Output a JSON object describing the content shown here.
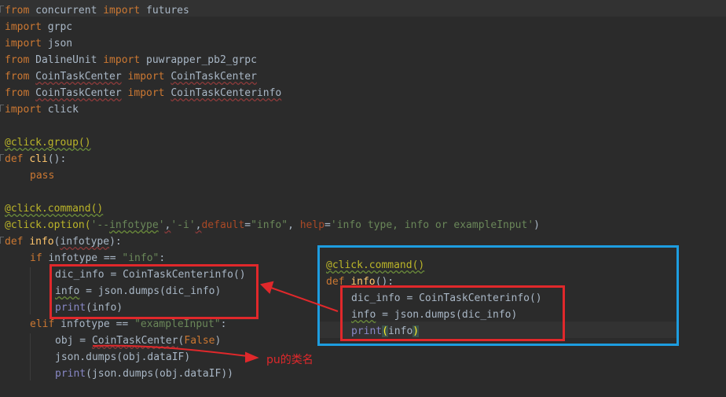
{
  "code": {
    "l1": {
      "a": "from",
      "b": " concurrent ",
      "c": "import",
      "d": " futures"
    },
    "l2": {
      "a": "import",
      "b": " grpc"
    },
    "l3": {
      "a": "import",
      "b": " json"
    },
    "l4": {
      "a": "from",
      "b": " DalineUnit ",
      "c": "import",
      "d": " puwrapper_pb2_grpc"
    },
    "l5": {
      "a": "from",
      "b": "CoinTaskCenter",
      "c": "import",
      "d": "CoinTaskCenter"
    },
    "l6": {
      "a": "from",
      "b": "CoinTaskCenter",
      "c": "import",
      "d": "CoinTaskCenterinfo"
    },
    "l7": {
      "a": "import",
      "b": " click"
    },
    "l9": {
      "a": "@click.group()"
    },
    "l10": {
      "a": "def",
      "b": "cli",
      "c": "():"
    },
    "l11": {
      "a": "pass"
    },
    "l13": {
      "a": "@click.command()"
    },
    "l14": {
      "a": "@click.option(",
      "b": "'--",
      "c": "infotype",
      "d": "'",
      "e": ",",
      "f": "'-i'",
      "g": ",",
      "h": "default",
      "i": "=",
      "j": "\"info\"",
      "k": ", ",
      "l": "help",
      "m": "=",
      "n": "'info type, info or exampleInput'",
      "o": ")"
    },
    "l15": {
      "a": "def",
      "b": "info",
      "c": "(",
      "d": "infotype",
      "e": "):"
    },
    "l16": {
      "a": "if",
      "b": " infotype == ",
      "c": "\"info\"",
      "d": ":"
    },
    "l17": {
      "a": "dic_info = CoinTaskCenterinfo()"
    },
    "l18": {
      "a": "info",
      "b": " = json.dumps(dic_info)"
    },
    "l19": {
      "a": "print",
      "b": "(info)"
    },
    "l20": {
      "a": "elif",
      "b": " infotype == ",
      "c": "\"exampleInput\"",
      "d": ":"
    },
    "l21": {
      "a": "obj = ",
      "b": "CoinTaskCenter",
      "c": "(",
      "d": "False",
      "e": ")"
    },
    "l22": {
      "a": "json.dumps(obj.dataIF)"
    },
    "l23": {
      "a": "print",
      "b": "(json.dumps(obj.dataIF))"
    }
  },
  "inset": {
    "l1": {
      "a": "@click.command()"
    },
    "l2": {
      "a": "def",
      "b": "info",
      "c": "():"
    },
    "l3": {
      "a": "dic_info = CoinTaskCenterinfo()"
    },
    "l4": {
      "a": "info",
      "b": " = json.dumps(dic_info)"
    },
    "l5": {
      "a": "print",
      "b": "(",
      "c": "info",
      "d": ")"
    }
  },
  "annotation": {
    "label": "pu的类名"
  },
  "colors": {
    "keyword": "#cc7832",
    "decorator": "#bbb529",
    "string": "#6a8759",
    "function": "#ffc66d",
    "background": "#2b2b2b",
    "highlight_box": "#1d9de0",
    "annotation": "#e0282b"
  }
}
